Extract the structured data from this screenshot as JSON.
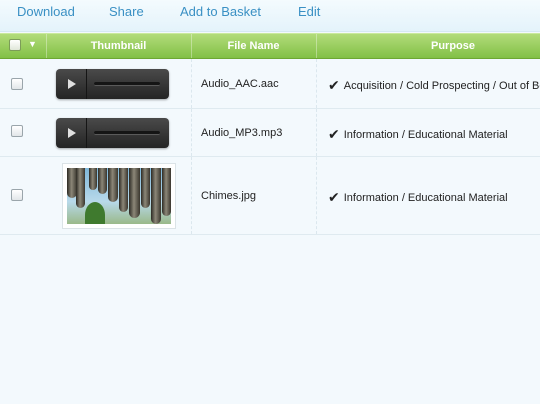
{
  "toolbar": {
    "download": "Download",
    "share": "Share",
    "add_to_basket": "Add to Basket",
    "edit": "Edit"
  },
  "table": {
    "columns": {
      "thumbnail": "Thumbnail",
      "file_name": "File Name",
      "purpose": "Purpose"
    },
    "rows": [
      {
        "type": "audio",
        "file_name": "Audio_AAC.aac",
        "purpose": "Acquisition / Cold Prospecting / Out of Boo"
      },
      {
        "type": "audio",
        "file_name": "Audio_MP3.mp3",
        "purpose": "Information / Educational Material"
      },
      {
        "type": "image",
        "file_name": "Chimes.jpg",
        "purpose": "Information / Educational Material"
      }
    ]
  },
  "colors": {
    "link": "#3a90c4",
    "header_green": "#82c046",
    "background": "#f3f9fd"
  }
}
